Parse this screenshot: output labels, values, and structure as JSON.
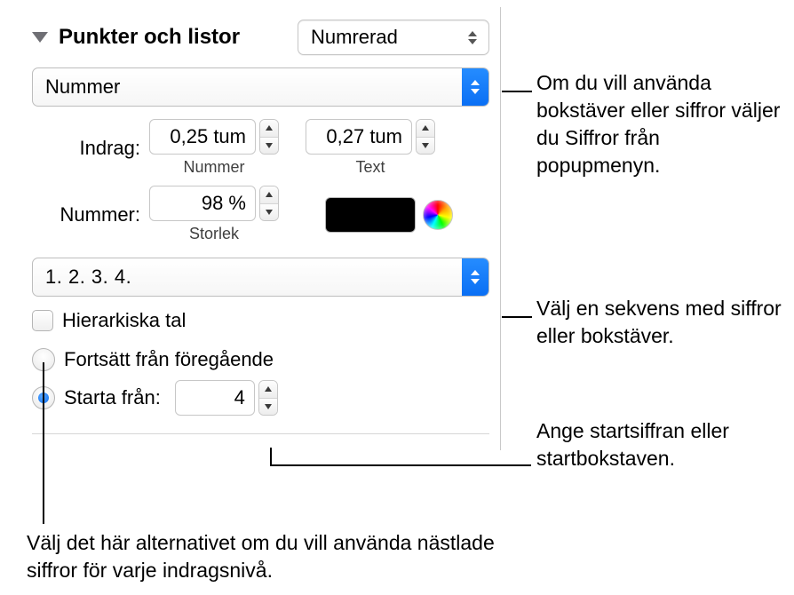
{
  "header": {
    "title": "Punkter och listor",
    "style_popup": "Numrerad"
  },
  "type_popup": "Nummer",
  "indent": {
    "label": "Indrag:",
    "number_value": "0,25 tum",
    "number_sublabel": "Nummer",
    "text_value": "0,27 tum",
    "text_sublabel": "Text"
  },
  "number": {
    "label": "Nummer:",
    "size_value": "98 %",
    "size_sublabel": "Storlek"
  },
  "sequence_popup": "1. 2. 3. 4.",
  "hierarchical_label": "Hierarkiska tal",
  "continue_label": "Fortsätt från föregående",
  "start_from": {
    "label": "Starta från:",
    "value": "4"
  },
  "annotations": {
    "a1": "Om du vill använda bokstäver eller siffror väljer du Siffror från popupmenyn.",
    "a2": "Välj en sekvens med siffror eller bokstäver.",
    "a3": "Ange startsiffran eller startbokstaven.",
    "a4": "Välj det här alternativet om du vill använda nästlade siffror för varje indragsnivå."
  }
}
